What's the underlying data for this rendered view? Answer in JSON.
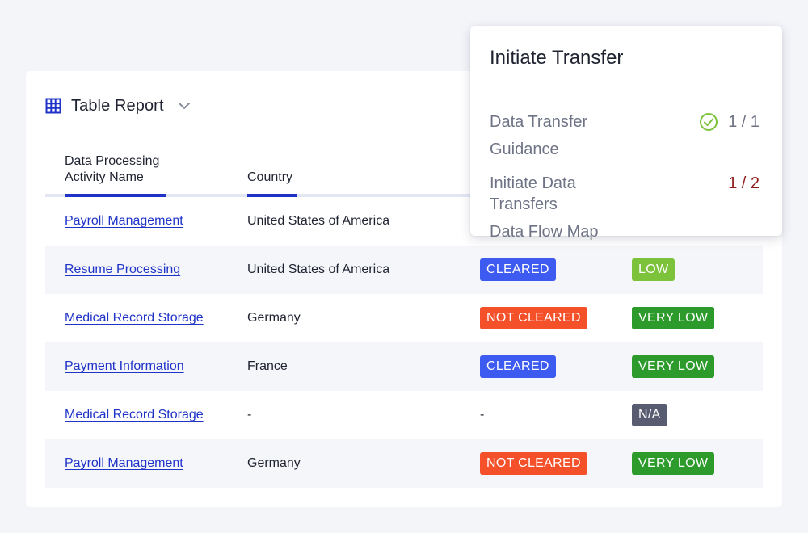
{
  "report": {
    "title": "Table Report",
    "columns": {
      "name_line1": "Data Processing",
      "name_line2": "Activity Name",
      "country": "Country"
    },
    "rows": [
      {
        "name": "Payroll Management",
        "country": "United States of America",
        "status": "",
        "status_color": "",
        "risk": "",
        "risk_color": ""
      },
      {
        "name": "Resume Processing",
        "country": "United States of America",
        "status": "CLEARED",
        "status_color": "#3d5af1",
        "risk": "LOW",
        "risk_color": "#7cc23a"
      },
      {
        "name": "Medical Record Storage",
        "country": "Germany",
        "status": "NOT CLEARED",
        "status_color": "#f4502a",
        "risk": "VERY LOW",
        "risk_color": "#2c9b2c"
      },
      {
        "name": "Payment Information",
        "country": "France",
        "status": "CLEARED",
        "status_color": "#3d5af1",
        "risk": "VERY LOW",
        "risk_color": "#2c9b2c"
      },
      {
        "name": "Medical Record Storage",
        "country": "-",
        "status": "-",
        "status_color": "",
        "risk": "N/A",
        "risk_color": "#585c70"
      },
      {
        "name": "Payroll Management",
        "country": "Germany",
        "status": "NOT CLEARED",
        "status_color": "#f4502a",
        "risk": "VERY LOW",
        "risk_color": "#2c9b2c"
      }
    ]
  },
  "popover": {
    "title": "Initiate Transfer",
    "steps": {
      "data_transfer": "Data Transfer",
      "guidance": "Guidance",
      "initiate_line1": "Initiate Data",
      "initiate_line2": "Transfers",
      "data_flow_map": "Data Flow Map"
    },
    "progress": {
      "data_transfer": "1 / 1",
      "initiate": "1 / 2"
    }
  },
  "colors": {
    "accent": "#1f33c9",
    "success": "#7cc23a",
    "danger_text": "#8f1b1b"
  },
  "icons": {
    "table": "grid-icon",
    "dropdown": "chevron-down-icon",
    "complete": "check-circle-icon"
  }
}
